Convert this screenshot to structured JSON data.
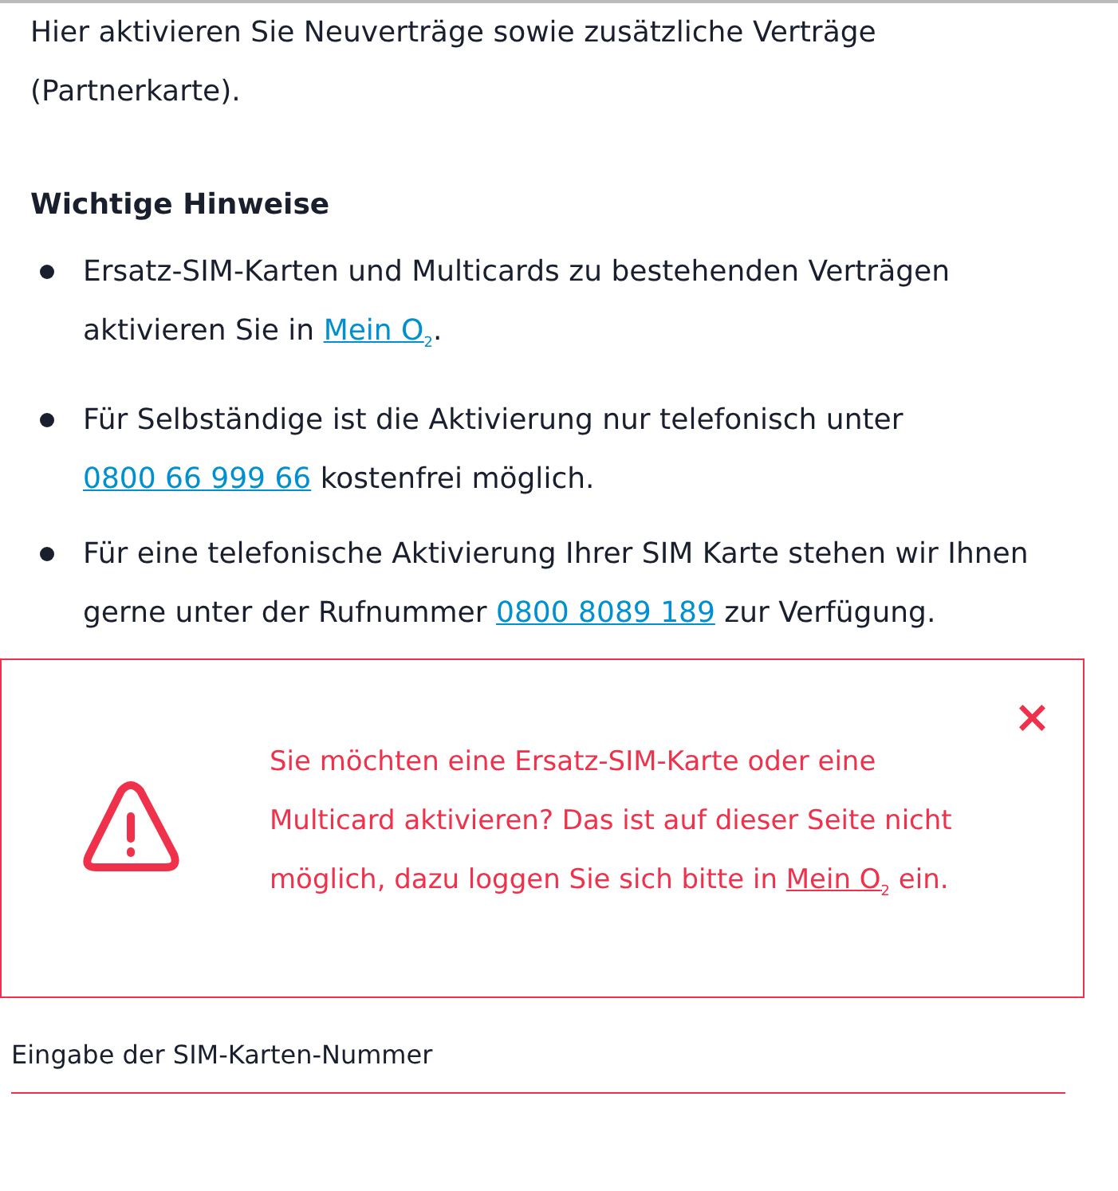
{
  "intro": "Hier aktivieren Sie Neuverträge sowie zusätzliche Verträge (Partnerkarte).",
  "notes": {
    "heading": "Wichtige Hinweise",
    "items": [
      {
        "before": "Ersatz-SIM-Karten und Multicards zu bestehenden Verträgen aktivieren Sie in ",
        "link": "Mein O$_{2}$",
        "after": "."
      },
      {
        "before": "Für Selbständige ist die Aktivierung nur telefonisch unter ",
        "link": "0800 66 999 66",
        "after": " kostenfrei möglich."
      },
      {
        "before": "Für eine telefonische Aktivierung Ihrer SIM Karte stehen wir Ihnen gerne unter der Rufnummer ",
        "link": "0800 8089 189",
        "after": " zur Verfügung."
      }
    ]
  },
  "alert": {
    "before": "Sie möchten eine Ersatz-SIM-Karte oder eine Multicard aktivieren? Das ist auf dieser Seite nicht möglich, dazu loggen Sie sich bitte in ",
    "link": "Mein O$_{2}$",
    "after": " ein.",
    "close": "×"
  },
  "field": {
    "label": "Eingabe der SIM-Karten-Nummer"
  }
}
